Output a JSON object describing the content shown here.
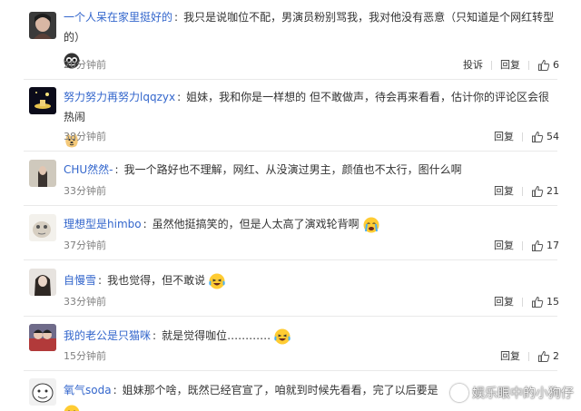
{
  "comments": [
    {
      "user": "一个人呆在家里挺好的",
      "text": "我只是说咖位不配，男演员粉别骂我，我对他没有恶意（只知道是个网红转型的）",
      "emoji": "sunglasses-face-icon",
      "time": "20分钟前",
      "report": "投诉",
      "reply": "回复",
      "likes": "6"
    },
    {
      "user": "努力努力再努力lqqzyx",
      "text": "姐妹，我和你是一样想的 但不敢做声，待会再来看看，估计你的评论区会很热闹",
      "emoji": "doge-face-icon",
      "time": "38分钟前",
      "reply": "回复",
      "likes": "54"
    },
    {
      "user": "CHU然然-",
      "text": "我一个路好也不理解，网红、从没演过男主，颜值也不太行，图什么啊",
      "time": "33分钟前",
      "reply": "回复",
      "likes": "21"
    },
    {
      "user": "理想型是himbo",
      "text": "虽然他挺搞笑的，但是人太高了演戏轮背啊",
      "emoji": "crying-face-icon",
      "time": "37分钟前",
      "reply": "回复",
      "likes": "17"
    },
    {
      "user": "自慢雪",
      "text": "我也觉得，但不敢说",
      "emoji": "laughing-tears-icon",
      "time": "33分钟前",
      "reply": "回复",
      "likes": "15"
    },
    {
      "user": "我的老公是只猫咪",
      "text": "就是觉得咖位…………",
      "emoji": "laughing-tears-icon",
      "time": "15分钟前",
      "reply": "回复",
      "likes": "2"
    },
    {
      "user": "氧气soda",
      "text": "姐妹那个啥，既然已经官宣了，咱就到时候先看看，完了以后要是",
      "emoji": "smile-face-icon",
      "time": "",
      "reply": "",
      "likes": ""
    }
  ],
  "watermark": "娱乐眼中的小狗仔",
  "colors": {
    "username": "#3366cc",
    "username_first": "#eb7350",
    "text": "#333333",
    "meta": "#808080",
    "separator": "#e9e9e9"
  }
}
